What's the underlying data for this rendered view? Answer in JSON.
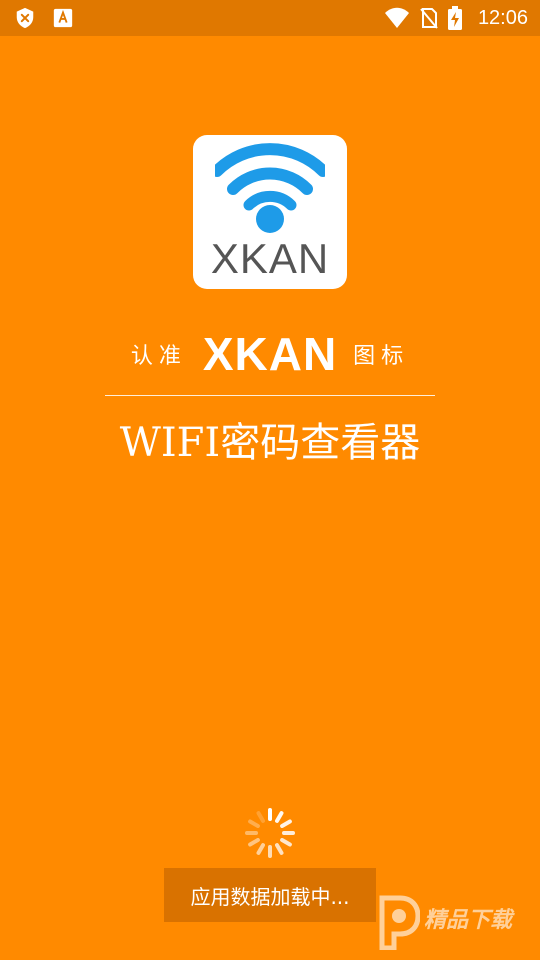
{
  "status_bar": {
    "time": "12:06",
    "icons": [
      "shield-x-icon",
      "font-a-icon",
      "wifi-icon",
      "no-sim-icon",
      "battery-charging-icon"
    ]
  },
  "logo": {
    "text": "XKAN",
    "icon": "wifi-icon"
  },
  "tagline": {
    "left": "认准",
    "brand": "XKAN",
    "right": "图标"
  },
  "title": "WIFI密码查看器",
  "loading": {
    "text": "应用数据加载中..."
  },
  "watermark": {
    "text": "精品下载"
  },
  "colors": {
    "background": "#FF8A00",
    "status_bar": "#E07800",
    "loading_box": "#D97200",
    "wifi_blue": "#1E9BE8",
    "logo_text": "#555555"
  }
}
